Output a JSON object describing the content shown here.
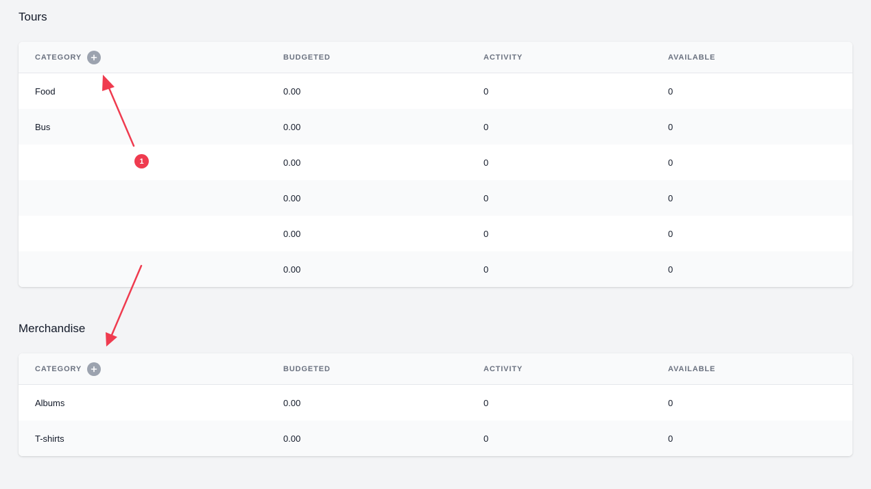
{
  "sections": [
    {
      "title": "Tours",
      "columns": [
        "CATEGORY",
        "BUDGETED",
        "ACTIVITY",
        "AVAILABLE"
      ],
      "rows": [
        {
          "category": "Food",
          "budgeted": "0.00",
          "activity": "0",
          "available": "0"
        },
        {
          "category": "Bus",
          "budgeted": "0.00",
          "activity": "0",
          "available": "0"
        },
        {
          "category": "",
          "budgeted": "0.00",
          "activity": "0",
          "available": "0"
        },
        {
          "category": "",
          "budgeted": "0.00",
          "activity": "0",
          "available": "0"
        },
        {
          "category": "",
          "budgeted": "0.00",
          "activity": "0",
          "available": "0"
        },
        {
          "category": "",
          "budgeted": "0.00",
          "activity": "0",
          "available": "0"
        }
      ]
    },
    {
      "title": "Merchandise",
      "columns": [
        "CATEGORY",
        "BUDGETED",
        "ACTIVITY",
        "AVAILABLE"
      ],
      "rows": [
        {
          "category": "Albums",
          "budgeted": "0.00",
          "activity": "0",
          "available": "0"
        },
        {
          "category": "T-shirts",
          "budgeted": "0.00",
          "activity": "0",
          "available": "0"
        }
      ]
    }
  ],
  "annotation": {
    "badge": "1",
    "color": "#ef3b4f"
  },
  "icons": {
    "add_category": "plus-icon"
  }
}
